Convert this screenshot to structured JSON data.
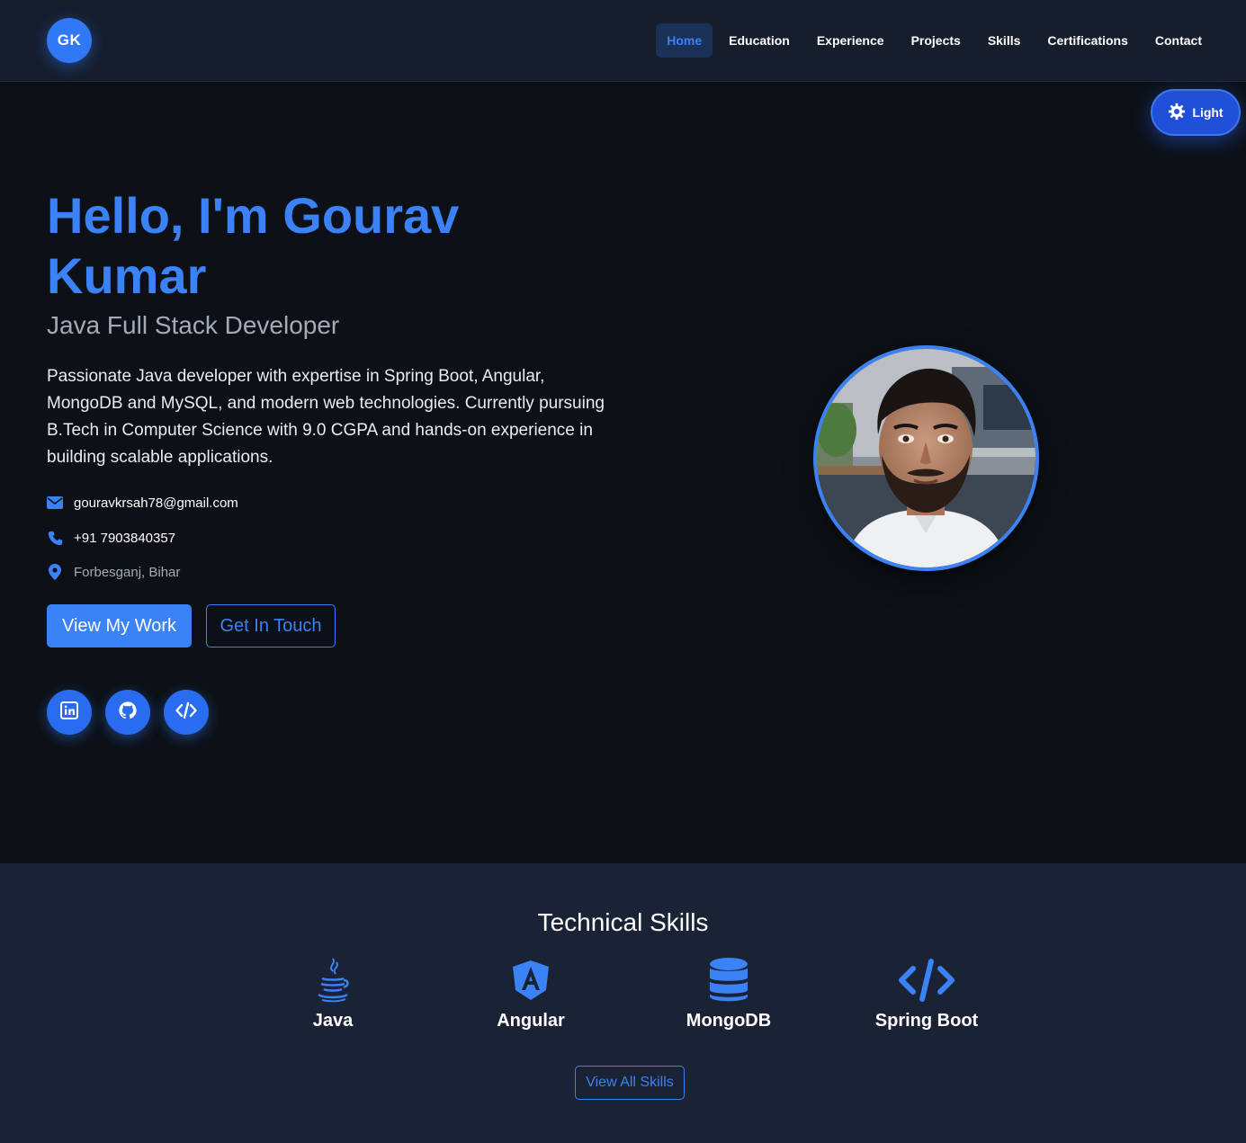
{
  "logo": {
    "text": "GK"
  },
  "nav": {
    "items": [
      {
        "label": "Home",
        "active": true
      },
      {
        "label": "Education"
      },
      {
        "label": "Experience"
      },
      {
        "label": "Projects"
      },
      {
        "label": "Skills"
      },
      {
        "label": "Certifications"
      },
      {
        "label": "Contact"
      }
    ]
  },
  "theme_toggle": {
    "label": "Light",
    "icon": "sun-icon"
  },
  "hero": {
    "title": "Hello, I'm Gourav Kumar",
    "subtitle": "Java Full Stack Developer",
    "description": "Passionate Java developer with expertise in Spring Boot, Angular, MongoDB and MySQL, and modern web technologies. Currently pursuing B.Tech in Computer Science with 9.0 CGPA and hands-on experience in building scalable applications.",
    "email": "gouravkrsah78@gmail.com",
    "phone": "+91 7903840357",
    "location": "Forbesganj, Bihar",
    "primary_button": "View My Work",
    "secondary_button": "Get In Touch",
    "socials": [
      "linkedin-icon",
      "github-icon",
      "code-icon"
    ]
  },
  "skills": {
    "title": "Technical Skills",
    "items": [
      {
        "label": "Java",
        "icon": "java-icon"
      },
      {
        "label": "Angular",
        "icon": "angular-icon"
      },
      {
        "label": "MongoDB",
        "icon": "database-icon"
      },
      {
        "label": "Spring Boot",
        "icon": "code-icon"
      }
    ],
    "button": "View All Skills"
  },
  "colors": {
    "accent": "#3b82f6",
    "background": "#0d1117",
    "navbar": "#161e2e",
    "skills_background": "#1a2236"
  }
}
